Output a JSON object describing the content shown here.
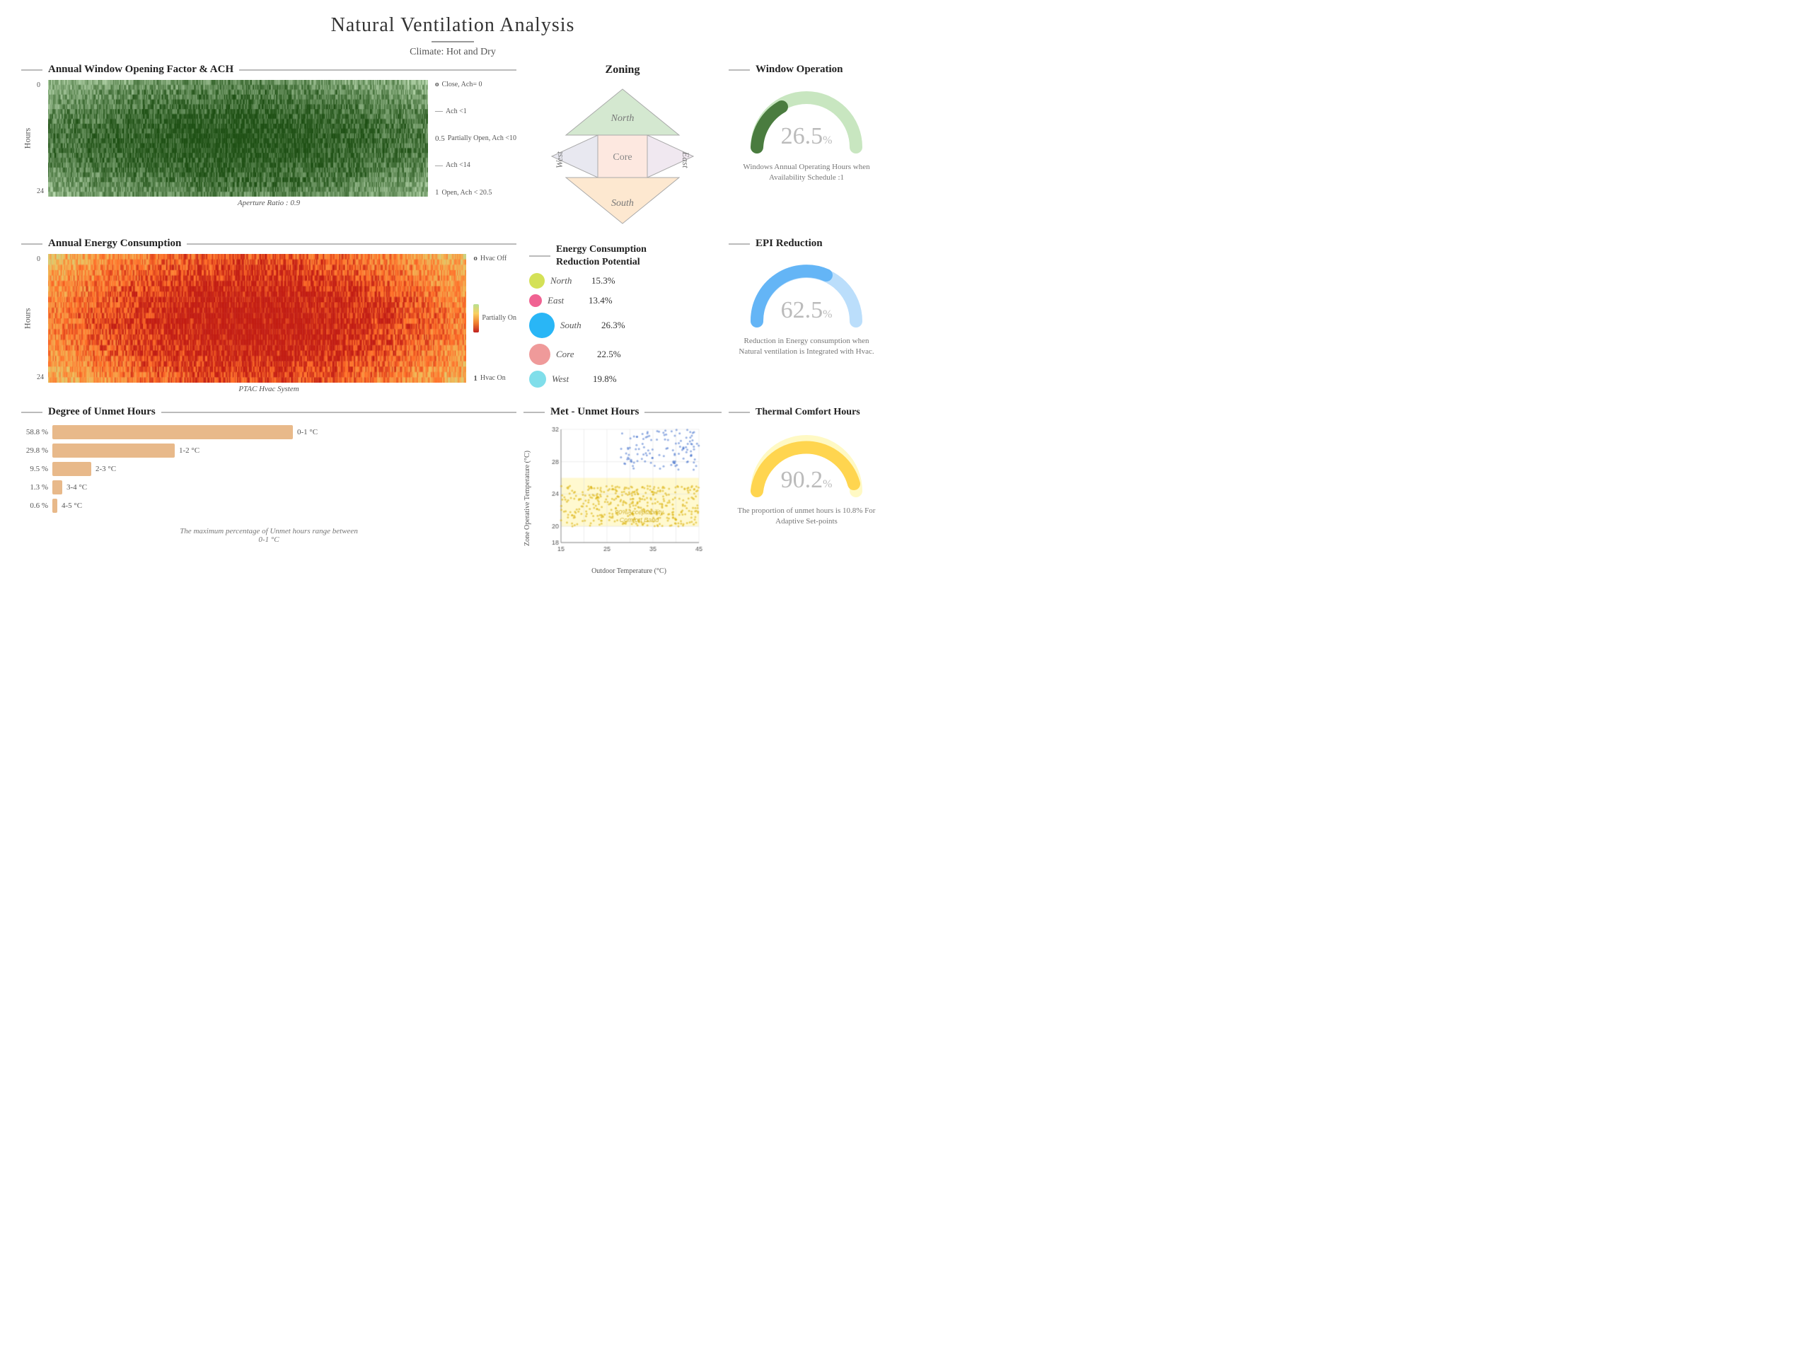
{
  "header": {
    "title": "Natural Ventilation Analysis",
    "subtitle": "Climate: Hot and Dry"
  },
  "window_opening": {
    "section_title": "Annual Window Opening Factor & ACH",
    "aperture_label": "Aperture Ratio : 0.9",
    "y_label": "Hours",
    "y_ticks": [
      "0",
      "24"
    ],
    "legend": [
      {
        "label": "Close, Ach= 0",
        "value": "0"
      },
      {
        "label": "Ach <1",
        "value": ""
      },
      {
        "label": "Partially Open, Ach <10",
        "value": "0.5"
      },
      {
        "label": "Ach <14",
        "value": ""
      },
      {
        "label": "Open, Ach < 20.5",
        "value": "1"
      }
    ]
  },
  "zoning": {
    "title": "Zoning",
    "zones": [
      "North",
      "East",
      "South",
      "West",
      "Core"
    ]
  },
  "window_operation": {
    "title": "Window Operation",
    "value": "26.5",
    "percent_symbol": "%",
    "description": "Windows Annual Operating Hours when Availability Schedule :1",
    "gauge_color": "#4a7c3f",
    "bg_color": "#c8e6c0"
  },
  "energy_consumption": {
    "section_title": "Annual Energy Consumption",
    "y_label": "Hours",
    "y_ticks": [
      "0",
      "24"
    ],
    "footnote": "PTAC Hvac System",
    "legend": [
      {
        "label": "Hvac Off",
        "value": "0"
      },
      {
        "label": "Partially On",
        "value": ""
      },
      {
        "label": "Hvac On",
        "value": "1"
      }
    ]
  },
  "ecp": {
    "title": "Energy Consumption Reduction Potential",
    "items": [
      {
        "zone": "North",
        "pct": "15.3%",
        "color": "#d4e157",
        "size": 22
      },
      {
        "zone": "East",
        "pct": "13.4%",
        "color": "#f06292",
        "size": 18
      },
      {
        "zone": "South",
        "pct": "26.3%",
        "color": "#29b6f6",
        "size": 36
      },
      {
        "zone": "Core",
        "pct": "22.5%",
        "color": "#ef9a9a",
        "size": 30
      },
      {
        "zone": "West",
        "pct": "19.8%",
        "color": "#80deea",
        "size": 24
      }
    ]
  },
  "epi": {
    "title": "EPI Reduction",
    "value": "62.5",
    "percent_symbol": "%",
    "description": "Reduction in Energy consumption when Natural ventilation is Integrated with Hvac.",
    "gauge_color": "#64b5f6",
    "bg_color": "#bbdefb"
  },
  "unmet_hours": {
    "title": "Degree of Unmet Hours",
    "bars": [
      {
        "pct": "58.8 %",
        "range": "0-1 °C",
        "width_pct": 100
      },
      {
        "pct": "29.8 %",
        "range": "1-2 °C",
        "width_pct": 51
      },
      {
        "pct": "9.5 %",
        "range": "2-3 °C",
        "width_pct": 16
      },
      {
        "pct": "1.3 %",
        "range": "3-4 °C",
        "width_pct": 4
      },
      {
        "pct": "0.6 %",
        "range": "4-5 °C",
        "width_pct": 2
      }
    ],
    "footnote": "The maximum percentage of Unmet hours range between\n0-1 °C"
  },
  "met_unmet": {
    "title": "Met - Unmet Hours",
    "x_label": "Outdoor Temperature (°C)",
    "y_label": "Zone Operative Temperature (°C)",
    "x_range": [
      15,
      45
    ],
    "y_range": [
      18,
      32
    ],
    "comfort_label": "90%Acceptability\nComfort Band",
    "x_ticks": [
      "15",
      "25",
      "35",
      "45"
    ],
    "y_ticks": [
      "18",
      "20",
      "24",
      "28",
      "32"
    ]
  },
  "thermal_comfort": {
    "title": "Thermal Comfort Hours",
    "value": "90.2",
    "percent_symbol": "%",
    "description": "The proportion of unmet hours is 10.8%  For Adaptive Set-points",
    "gauge_color": "#ffd54f",
    "bg_color": "#fff9c4"
  }
}
